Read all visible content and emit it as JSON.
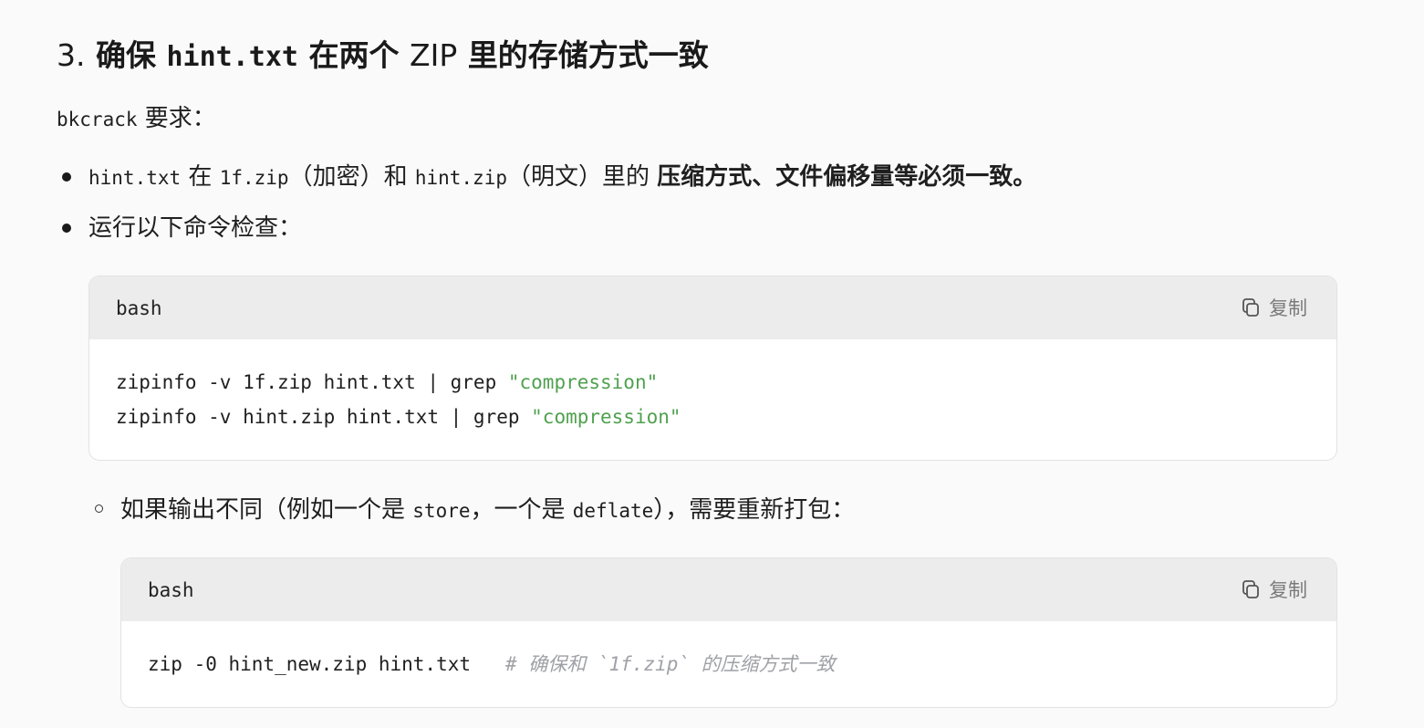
{
  "heading": {
    "number": "3.",
    "prefix": "确保",
    "code": "hint.txt",
    "middle": "在两个",
    "zip_word": "ZIP",
    "suffix": "里的存储方式一致"
  },
  "intro": {
    "code": "bkcrack",
    "text": "要求："
  },
  "bullets": [
    {
      "code1": "hint.txt",
      "t1": "在",
      "code2": "1f.zip",
      "t2": "（加密）和",
      "code3": "hint.zip",
      "t3": "（明文）里的",
      "strong": "压缩方式、文件偏移量等必须一致。"
    },
    {
      "text": "运行以下命令检查："
    }
  ],
  "code_block_1": {
    "language": "bash",
    "copy_label": "复制",
    "lines": [
      {
        "plain": "zipinfo -v 1f.zip hint.txt | grep ",
        "string": "\"compression\""
      },
      {
        "plain": "zipinfo -v hint.zip hint.txt | grep ",
        "string": "\"compression\""
      }
    ]
  },
  "sub_bullet": {
    "t1": "如果输出不同（例如一个是",
    "code1": "store",
    "t2": "，一个是",
    "code2": "deflate",
    "t3": "），需要重新打包："
  },
  "code_block_2": {
    "language": "bash",
    "copy_label": "复制",
    "plain": "zip -0 hint_new.zip hint.txt   ",
    "comment": "# 确保和 `1f.zip` 的压缩方式一致"
  },
  "icons": {
    "copy": "copy-icon",
    "bullet": "disc-bullet",
    "sub_bullet": "circle-bullet"
  },
  "colors": {
    "string": "#50a14f",
    "comment": "#a0a1a7",
    "code_header_bg": "#ececec",
    "page_bg": "#fafafa"
  }
}
